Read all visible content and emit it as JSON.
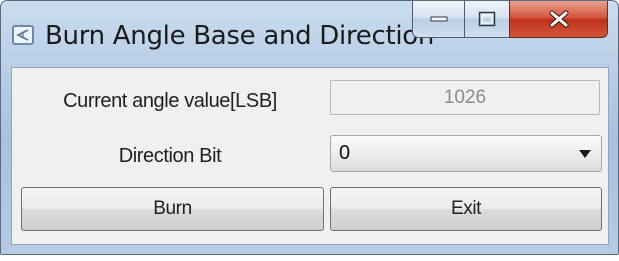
{
  "window": {
    "title": "Burn Angle Base and Direction",
    "icon": "app-window-icon",
    "controls": {
      "minimize_icon": "minimize-icon",
      "maximize_icon": "maximize-icon",
      "close_icon": "close-icon"
    }
  },
  "form": {
    "angle_label": "Current angle value[LSB]",
    "angle_value": "1026",
    "direction_label": "Direction Bit",
    "direction_selected": "0"
  },
  "buttons": {
    "burn_label": "Burn",
    "exit_label": "Exit"
  },
  "colors": {
    "title_gradient_top": "#c9dcef",
    "close_button_red": "#bf3219",
    "client_background": "#f0f0f0"
  }
}
